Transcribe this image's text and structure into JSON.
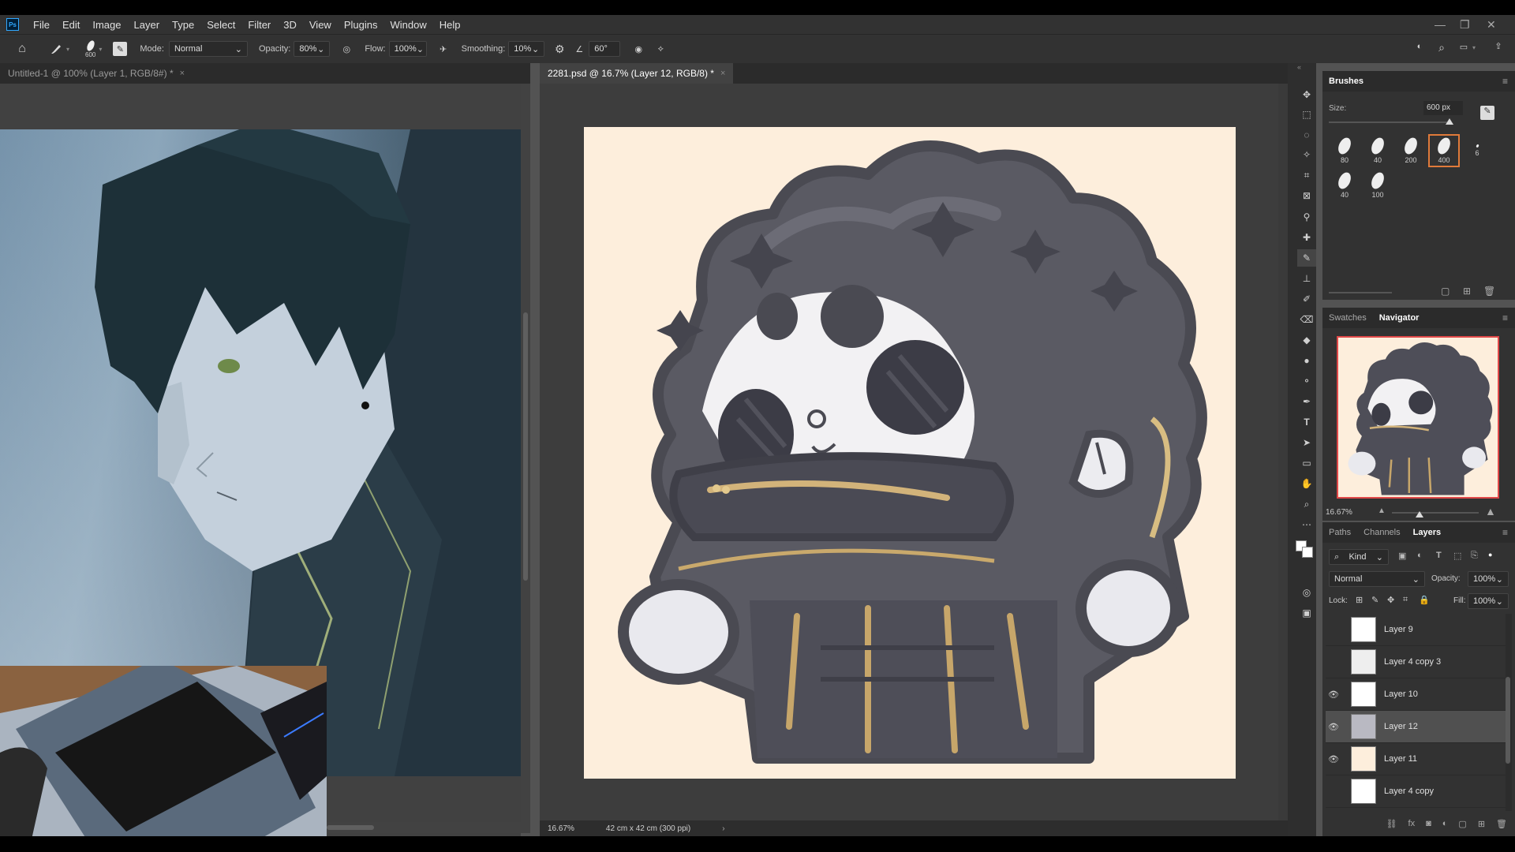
{
  "menu": [
    "File",
    "Edit",
    "Image",
    "Layer",
    "Type",
    "Select",
    "Filter",
    "3D",
    "View",
    "Plugins",
    "Window",
    "Help"
  ],
  "app_badge": "Ps",
  "options": {
    "brush_size": "600",
    "mode_label": "Mode:",
    "mode_value": "Normal",
    "opacity_label": "Opacity:",
    "opacity_value": "80%",
    "flow_label": "Flow:",
    "flow_value": "100%",
    "smoothing_label": "Smoothing:",
    "smoothing_value": "10%",
    "angle_value": "60°"
  },
  "tabs": {
    "left": "Untitled-1 @ 100% (Layer 1, RGB/8#) *",
    "right": "2281.psd @ 16.7% (Layer 12, RGB/8) *"
  },
  "status": {
    "zoom": "16.67%",
    "doc_info": "42 cm x 42 cm (300 ppi)"
  },
  "brushes_panel": {
    "title": "Brushes",
    "size_label": "Size:",
    "size_value": "600 px",
    "presets": [
      "80",
      "40",
      "200",
      "400",
      "6",
      "40",
      "100"
    ],
    "selected_index": 3
  },
  "navigator_panel": {
    "tabs": [
      "Swatches",
      "Navigator"
    ],
    "active": "Navigator",
    "zoom": "16.67%"
  },
  "layers_panel": {
    "tabs": [
      "Paths",
      "Channels",
      "Layers"
    ],
    "active": "Layers",
    "kind_label": "Kind",
    "blend_mode": "Normal",
    "opacity_label": "Opacity:",
    "opacity_value": "100%",
    "lock_label": "Lock:",
    "fill_label": "Fill:",
    "fill_value": "100%",
    "layers": [
      {
        "name": "Layer 9",
        "visible": false
      },
      {
        "name": "Layer 4 copy 3",
        "visible": false
      },
      {
        "name": "Layer 10",
        "visible": true
      },
      {
        "name": "Layer 12",
        "visible": true,
        "selected": true
      },
      {
        "name": "Layer 11",
        "visible": true
      },
      {
        "name": "Layer 4 copy",
        "visible": false
      }
    ]
  },
  "colors": {
    "canvas_bg": "#fdeedc",
    "ui_dark": "#323232",
    "accent": "#e07a3a"
  }
}
